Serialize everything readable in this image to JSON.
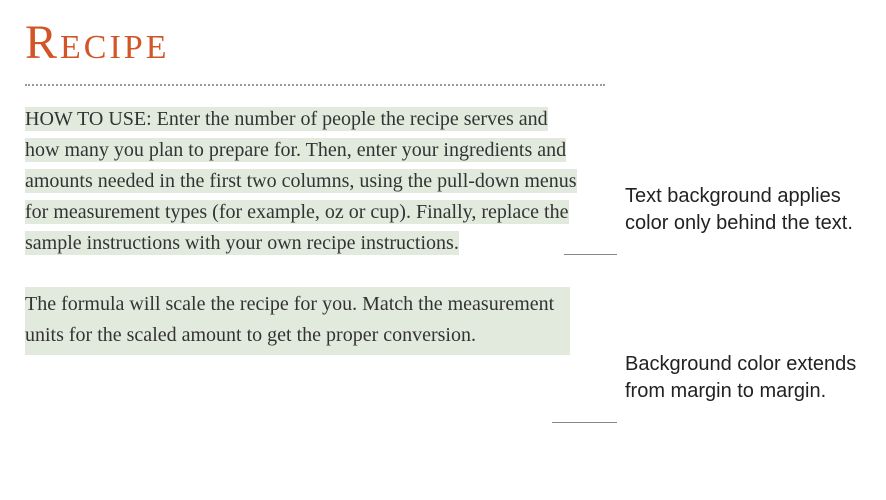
{
  "doc": {
    "title": "Recipe",
    "paragraph1": "HOW TO USE: Enter the number of people the recipe serves and how many you plan to prepare for. Then, enter your ingredients and amounts needed in the first two columns, using the pull-down menus for measurement types (for example, oz or cup). Finally, replace the sample instructions with your own recipe instructions.",
    "paragraph2": "The formula will scale the recipe for you. Match the measurement units for the scaled amount to get the proper conversion."
  },
  "callouts": {
    "callout1": "Text background applies color only behind the text.",
    "callout2": "Background color extends from margin to margin."
  },
  "colors": {
    "title": "#d35427",
    "highlight": "#e2eadd"
  }
}
